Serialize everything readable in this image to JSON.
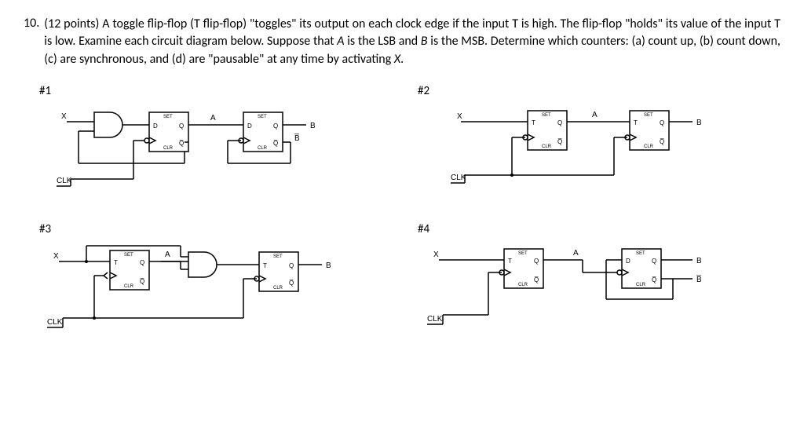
{
  "question": {
    "number": "10.",
    "points": "(12 points)",
    "text_a": "A toggle flip-flop (T flip-flop) \"toggles\" its output on each clock edge if the input T is high.  The flip-flop \"holds\" its value of the input T is low. Examine each circuit diagram below.  Suppose that ",
    "lsb": "A",
    "text_b": " is the LSB and ",
    "msb": "B",
    "text_c": " is the MSB.  Determine which counters: (a) count up, (b) count down, (c) are synchronous, and (d) are \"pausable\" at any time by activating ",
    "xvar": "X",
    "text_d": "."
  },
  "circuits": {
    "c1": "#1",
    "c2": "#2",
    "c3": "#3",
    "c4": "#4"
  },
  "pins": {
    "D": "D",
    "T": "T",
    "Q": "Q",
    "Qn": "Q̅",
    "SET": "SET",
    "CLR": "CLR",
    "X": "X",
    "CLK": "CLK",
    "A": "A",
    "B": "B",
    "Bn": "B̅"
  }
}
